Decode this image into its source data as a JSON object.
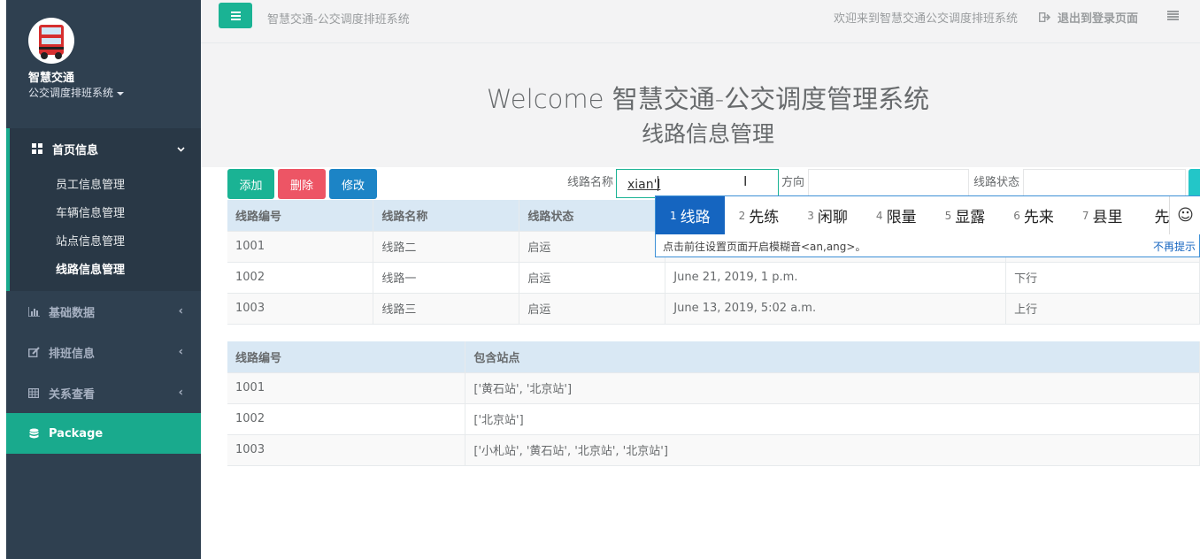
{
  "sidebar": {
    "brand": "智慧交通",
    "subtitle": "公交调度排班系统",
    "home_group": {
      "label": "首页信息",
      "items": [
        {
          "label": "员工信息管理"
        },
        {
          "label": "车辆信息管理"
        },
        {
          "label": "站点信息管理"
        },
        {
          "label": "线路信息管理"
        }
      ]
    },
    "items": [
      {
        "label": "基础数据",
        "icon": "bar-chart-icon"
      },
      {
        "label": "排班信息",
        "icon": "edit-icon"
      },
      {
        "label": "关系查看",
        "icon": "table-icon"
      },
      {
        "label": "Package",
        "icon": "database-icon"
      }
    ]
  },
  "topbar": {
    "title": "智慧交通-公交调度排班系统",
    "welcome": "欢迎来到智慧交通公交调度排班系统",
    "logout": "退出到登录页面"
  },
  "main": {
    "heading": "Welcome 智慧交通-公交调度管理系统",
    "subheading": "线路信息管理"
  },
  "toolbar": {
    "add": "添加",
    "delete": "删除",
    "edit": "修改",
    "route_name_label": "线路名称",
    "route_name_value": "xian'l",
    "direction_label": "方向",
    "status_label": "线路状态"
  },
  "table1": {
    "headers": [
      "线路编号",
      "线路名称",
      "线路状态",
      "",
      ""
    ],
    "rows": [
      [
        "1001",
        "线路二",
        "启运",
        "",
        ""
      ],
      [
        "1002",
        "线路一",
        "启运",
        "June 21, 2019, 1 p.m.",
        "下行"
      ],
      [
        "1003",
        "线路三",
        "启运",
        "June 13, 2019, 5:02 a.m.",
        "上行"
      ]
    ]
  },
  "table2": {
    "headers": [
      "线路编号",
      "包含站点"
    ],
    "rows": [
      [
        "1001",
        "['黄石站', '北京站']"
      ],
      [
        "1002",
        "['北京站']"
      ],
      [
        "1003",
        "['小札站', '黄石站', '北京站', '北京站']"
      ]
    ]
  },
  "ime": {
    "candidates": [
      {
        "n": "1",
        "text": "线路"
      },
      {
        "n": "2",
        "text": "先练"
      },
      {
        "n": "3",
        "text": "闲聊"
      },
      {
        "n": "4",
        "text": "限量"
      },
      {
        "n": "5",
        "text": "显露"
      },
      {
        "n": "6",
        "text": "先来"
      },
      {
        "n": "7",
        "text": "县里"
      },
      {
        "n": "",
        "text": "先"
      }
    ],
    "hint": "点击前往设置页面开启模糊音<an,ang>。",
    "no_more": "不再提示",
    "emoji": "☺"
  },
  "colors": {
    "sidebar": "#2f4050",
    "accent": "#1ab394",
    "danger": "#ed5565",
    "primary": "#1c84c6"
  }
}
